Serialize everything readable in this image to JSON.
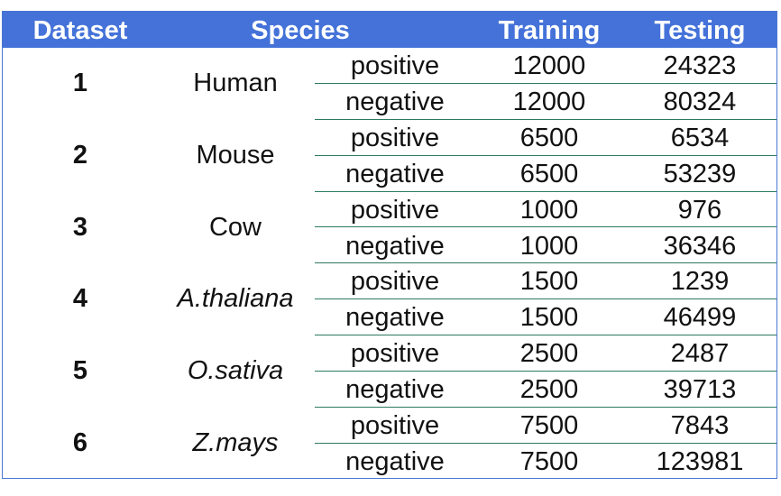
{
  "header": {
    "dataset": "Dataset",
    "species": "Species",
    "training": "Training",
    "testing": "Testing"
  },
  "rows": [
    {
      "dataset": "1",
      "species": "Human",
      "italic": false,
      "classes": [
        {
          "label": "positive",
          "training": "12000",
          "testing": "24323"
        },
        {
          "label": "negative",
          "training": "12000",
          "testing": "80324"
        }
      ]
    },
    {
      "dataset": "2",
      "species": "Mouse",
      "italic": false,
      "classes": [
        {
          "label": "positive",
          "training": "6500",
          "testing": "6534"
        },
        {
          "label": "negative",
          "training": "6500",
          "testing": "53239"
        }
      ]
    },
    {
      "dataset": "3",
      "species": "Cow",
      "italic": false,
      "classes": [
        {
          "label": "positive",
          "training": "1000",
          "testing": "976"
        },
        {
          "label": "negative",
          "training": "1000",
          "testing": "36346"
        }
      ]
    },
    {
      "dataset": "4",
      "species": "A.thaliana",
      "italic": true,
      "classes": [
        {
          "label": "positive",
          "training": "1500",
          "testing": "1239"
        },
        {
          "label": "negative",
          "training": "1500",
          "testing": "46499"
        }
      ]
    },
    {
      "dataset": "5",
      "species": "O.sativa",
      "italic": true,
      "classes": [
        {
          "label": "positive",
          "training": "2500",
          "testing": "2487"
        },
        {
          "label": "negative",
          "training": "2500",
          "testing": "39713"
        }
      ]
    },
    {
      "dataset": "6",
      "species": "Z.mays",
      "italic": true,
      "classes": [
        {
          "label": "positive",
          "training": "7500",
          "testing": "7843"
        },
        {
          "label": "negative",
          "training": "7500",
          "testing": "123981"
        }
      ]
    }
  ],
  "colors": {
    "header_bg": "#4472d9",
    "header_text": "#ffffff",
    "row_divider": "#2e7a5f"
  }
}
